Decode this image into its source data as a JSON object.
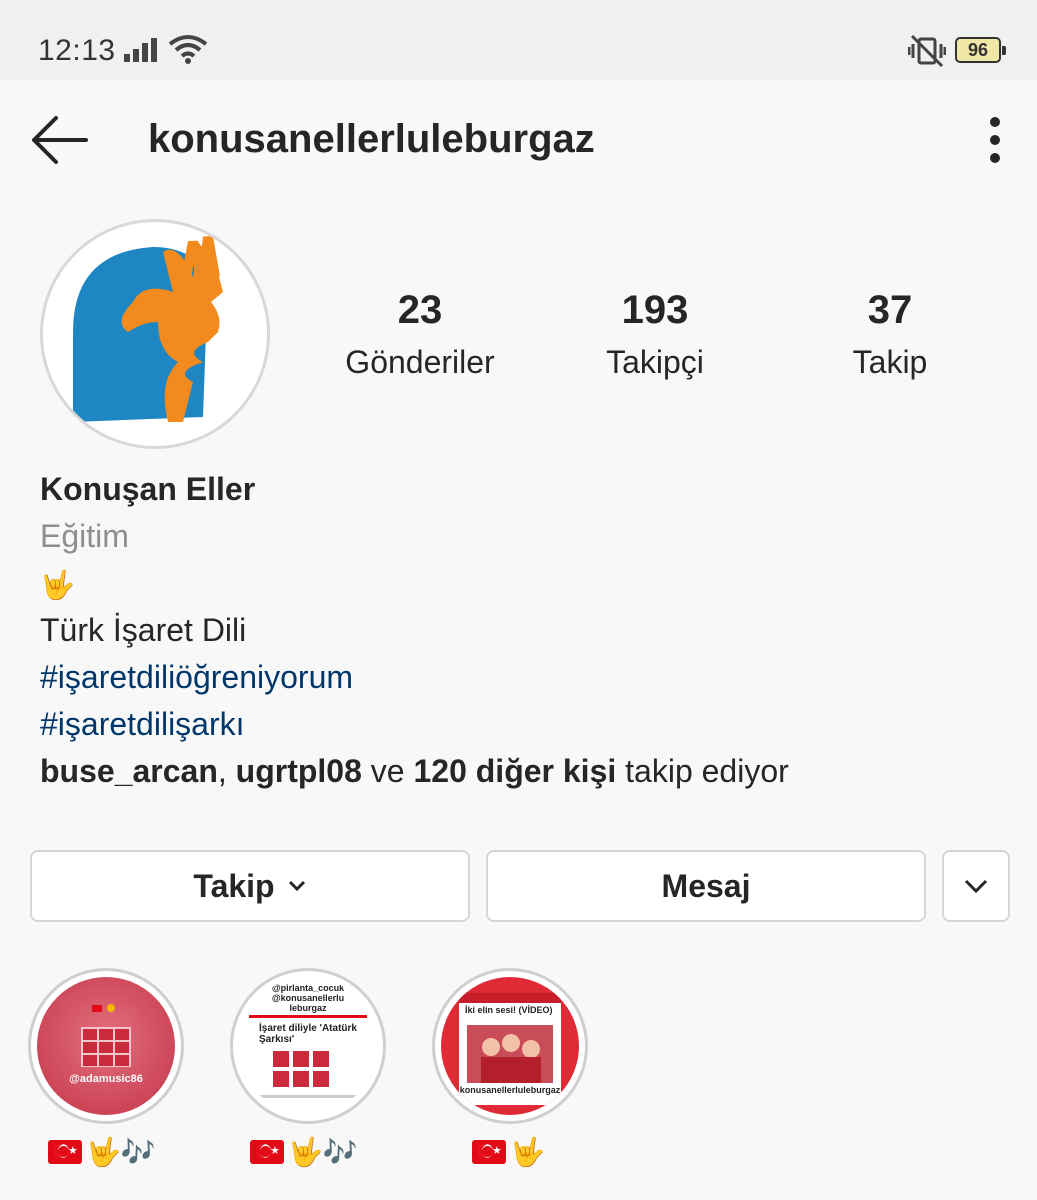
{
  "status_bar": {
    "time": "12:13",
    "battery": "96",
    "icons": [
      "signal-icon",
      "wifi-icon",
      "vibrate-mute-icon",
      "battery-icon"
    ]
  },
  "header": {
    "username": "konusanellerluleburgaz",
    "back_icon": "arrow-left-icon",
    "more_icon": "vertical-dots-icon"
  },
  "stats": [
    {
      "count": "23",
      "label": "Gönderiler"
    },
    {
      "count": "193",
      "label": "Takipçi"
    },
    {
      "count": "37",
      "label": "Takip"
    }
  ],
  "bio": {
    "name": "Konuşan Eller",
    "category": "Eğitim",
    "emoji": "🤟",
    "text": "Türk İşaret Dili",
    "hashtags": [
      "#işaretdiliöğreniyorum",
      "#işaretdilişarkı"
    ],
    "followed_by": {
      "user1": "buse_arcan",
      "sep": ", ",
      "user2": "ugrtpl08",
      "and": " ve ",
      "others": "120 diğer kişi",
      "suffix": " takip ediyor"
    }
  },
  "actions": {
    "follow_label": "Takip",
    "message_label": "Mesaj"
  },
  "highlights": [
    {
      "label_emojis": "🤟🎶",
      "thumb_text": "@adamusic86",
      "thumb_texts": []
    },
    {
      "label_emojis": "🤟🎶",
      "thumb_text": "İşaret diliyle 'Atatürk Şarkısı'",
      "thumb_texts": [
        "@pirlanta_cocuk",
        "@konusanellerlu",
        "leburgaz"
      ]
    },
    {
      "label_emojis": "🤟",
      "thumb_text": "İki elin sesi! (VİDEO)",
      "thumb_texts": [
        "konusanellerluleburgaz"
      ]
    }
  ],
  "colors": {
    "accent_link": "#00376b",
    "category_gray": "#8e8e8e",
    "logo_blue": "#1e87c3",
    "logo_orange": "#f28a1e"
  }
}
